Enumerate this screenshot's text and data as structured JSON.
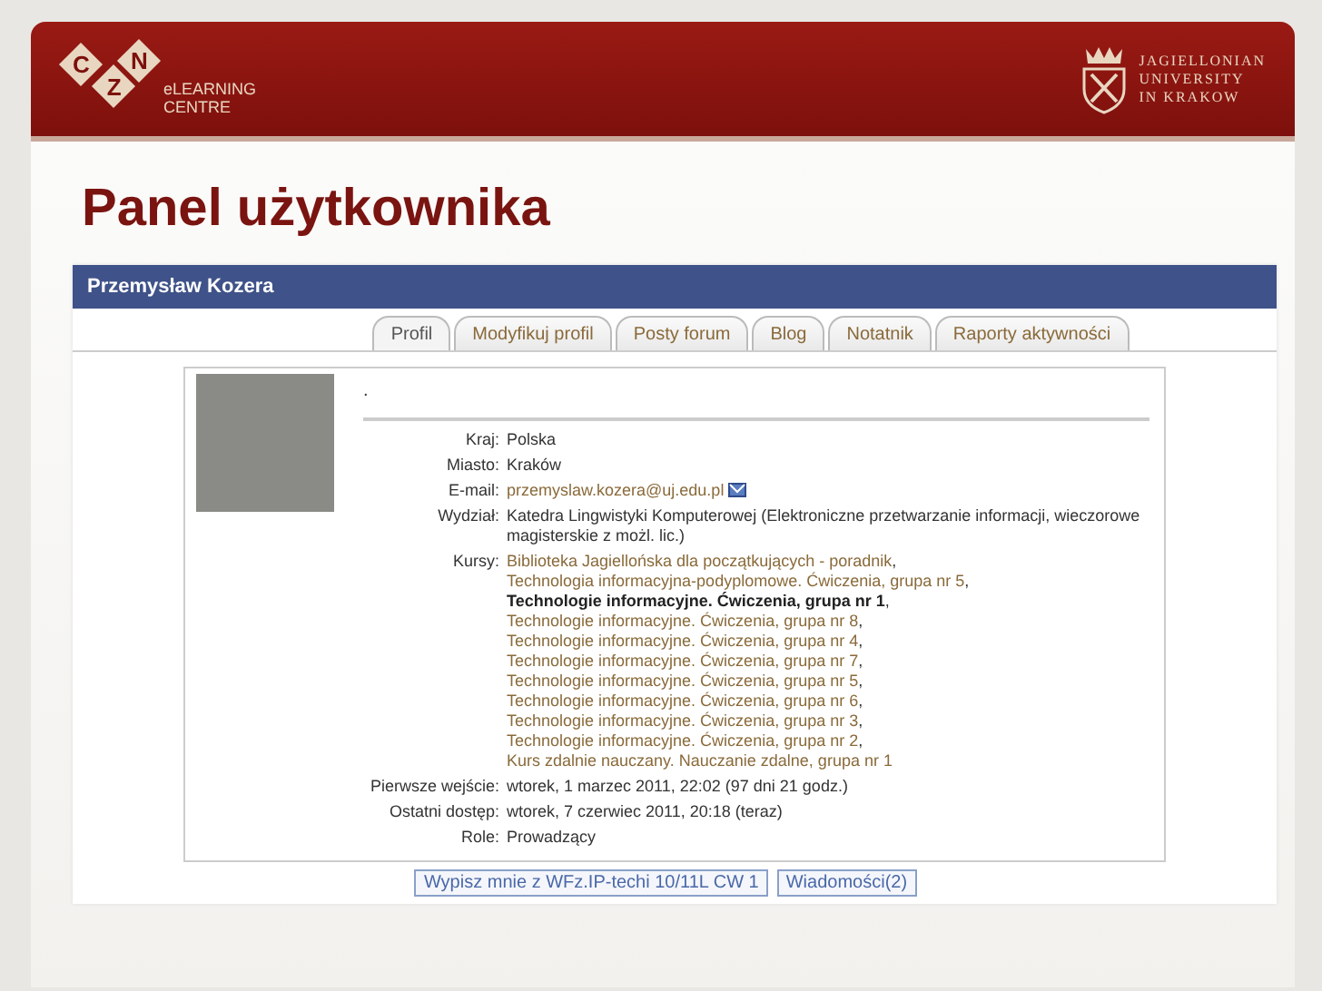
{
  "header": {
    "logo_left": {
      "letters": [
        "C",
        "Z",
        "N"
      ],
      "lines": [
        "eLEARNING",
        "CENTRE"
      ]
    },
    "logo_right": {
      "lines": [
        "JAGIELLONIAN",
        "UNIVERSITY",
        "IN KRAKOW"
      ]
    }
  },
  "slide_title": "Panel użytkownika",
  "user_name": "Przemysław Kozera",
  "tabs": [
    {
      "label": "Profil",
      "selected": true
    },
    {
      "label": "Modyfikuj profil",
      "selected": false
    },
    {
      "label": "Posty forum",
      "selected": false
    },
    {
      "label": "Blog",
      "selected": false
    },
    {
      "label": "Notatnik",
      "selected": false
    },
    {
      "label": "Raporty aktywności",
      "selected": false
    }
  ],
  "profile": {
    "description": ".",
    "fields": [
      {
        "kind": "text",
        "label": "Kraj:",
        "value": "Polska"
      },
      {
        "kind": "text",
        "label": "Miasto:",
        "value": "Kraków"
      },
      {
        "kind": "email",
        "label": "E-mail:",
        "value": "przemyslaw.kozera@uj.edu.pl"
      },
      {
        "kind": "text",
        "label": "Wydział:",
        "value": "Katedra Lingwistyki Komputerowej (Elektroniczne przetwarzanie informacji, wieczorowe magisterskie z możl. lic.)"
      },
      {
        "kind": "courses",
        "label": "Kursy:",
        "separator": ",",
        "courses": [
          {
            "name": "Biblioteka Jagiellońska dla początkujących - poradnik",
            "selected": false
          },
          {
            "name": "Technologia informacyjna-podyplomowe. Ćwiczenia, grupa nr 5",
            "selected": false
          },
          {
            "name": "Technologie informacyjne. Ćwiczenia, grupa nr 1",
            "selected": true
          },
          {
            "name": "Technologie informacyjne. Ćwiczenia, grupa nr 8",
            "selected": false
          },
          {
            "name": "Technologie informacyjne. Ćwiczenia, grupa nr 4",
            "selected": false
          },
          {
            "name": "Technologie informacyjne. Ćwiczenia, grupa nr 7",
            "selected": false
          },
          {
            "name": "Technologie informacyjne. Ćwiczenia, grupa nr 5",
            "selected": false
          },
          {
            "name": "Technologie informacyjne. Ćwiczenia, grupa nr 6",
            "selected": false
          },
          {
            "name": "Technologie informacyjne. Ćwiczenia, grupa nr 3",
            "selected": false
          },
          {
            "name": "Technologie informacyjne. Ćwiczenia, grupa nr 2",
            "selected": false
          },
          {
            "name": "Kurs zdalnie nauczany. Nauczanie zdalne, grupa nr 1",
            "selected": false
          }
        ]
      },
      {
        "kind": "text",
        "label": "Pierwsze wejście:",
        "value": "wtorek, 1 marzec 2011, 22:02  (97 dni 21 godz.)"
      },
      {
        "kind": "text",
        "label": "Ostatni dostęp:",
        "value": "wtorek, 7 czerwiec 2011, 20:18  (teraz)"
      },
      {
        "kind": "text",
        "label": "Role:",
        "value": "Prowadzący"
      }
    ]
  },
  "buttons": [
    "Wypisz mnie z WFz.IP-techi 10/11L CW 1",
    "Wiadomości(2)"
  ]
}
